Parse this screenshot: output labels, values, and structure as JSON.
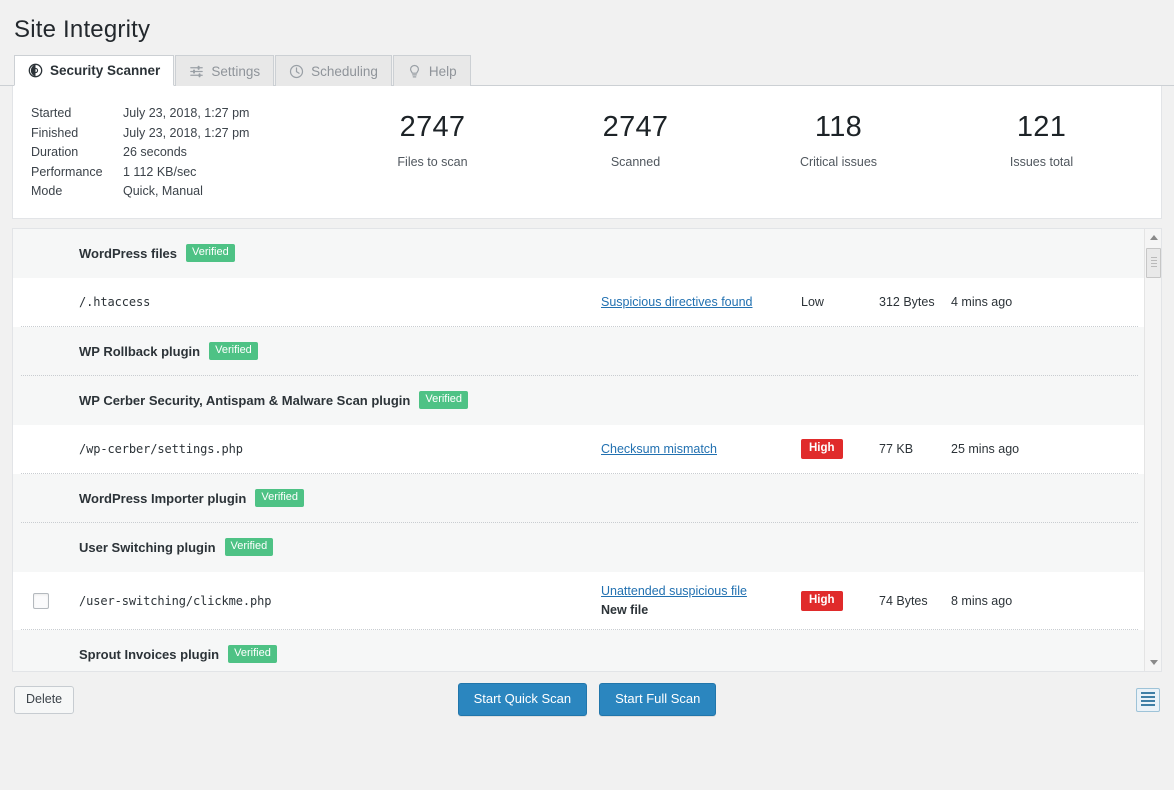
{
  "page": {
    "title": "Site Integrity"
  },
  "tabs": [
    {
      "label": "Security Scanner",
      "icon": "shield-clock-icon",
      "active": true
    },
    {
      "label": "Settings",
      "icon": "sliders-icon",
      "active": false
    },
    {
      "label": "Scheduling",
      "icon": "clock-icon",
      "active": false
    },
    {
      "label": "Help",
      "icon": "lightbulb-icon",
      "active": false
    }
  ],
  "summary": {
    "meta": [
      {
        "key": "Started",
        "value": "July 23, 2018, 1:27 pm"
      },
      {
        "key": "Finished",
        "value": "July 23, 2018, 1:27 pm"
      },
      {
        "key": "Duration",
        "value": "26 seconds"
      },
      {
        "key": "Performance",
        "value": "1 112 KB/sec"
      },
      {
        "key": "Mode",
        "value": "Quick, Manual"
      }
    ],
    "stats": [
      {
        "value": "2747",
        "label": "Files to scan"
      },
      {
        "value": "2747",
        "label": "Scanned"
      },
      {
        "value": "118",
        "label": "Critical issues"
      },
      {
        "value": "121",
        "label": "Issues total"
      }
    ]
  },
  "results": {
    "verified_badge": "Verified",
    "rows": [
      {
        "type": "group",
        "name": "WordPress files",
        "badge": "Verified"
      },
      {
        "type": "file",
        "checkbox": false,
        "name": "/.htaccess",
        "issue": "Suspicious directives found",
        "issue_sub": "",
        "severity": "Low",
        "severity_level": "low",
        "size": "312 Bytes",
        "time": "4 mins ago",
        "separator": true
      },
      {
        "type": "group",
        "name": "WP Rollback plugin",
        "badge": "Verified",
        "separator": true
      },
      {
        "type": "group",
        "name": "WP Cerber Security, Antispam & Malware Scan plugin",
        "badge": "Verified"
      },
      {
        "type": "file",
        "checkbox": false,
        "name": "/wp-cerber/settings.php",
        "issue": "Checksum mismatch",
        "issue_sub": "",
        "severity": "High",
        "severity_level": "high",
        "size": "77 KB",
        "time": "25 mins ago",
        "separator": true
      },
      {
        "type": "group",
        "name": "WordPress Importer plugin",
        "badge": "Verified",
        "separator": true
      },
      {
        "type": "group",
        "name": "User Switching plugin",
        "badge": "Verified"
      },
      {
        "type": "file",
        "checkbox": true,
        "name": "/user-switching/clickme.php",
        "issue": "Unattended suspicious file",
        "issue_sub": "New file",
        "severity": "High",
        "severity_level": "high",
        "size": "74 Bytes",
        "time": "8 mins ago",
        "separator": true
      },
      {
        "type": "group",
        "name": "Sprout Invoices plugin",
        "badge": "Verified"
      }
    ]
  },
  "toolbar": {
    "delete_label": "Delete",
    "quick_scan_label": "Start Quick Scan",
    "full_scan_label": "Start Full Scan",
    "view_toggle_icon": "list-view-icon"
  },
  "colors": {
    "accent": "#2b86bf",
    "verified": "#4ec285",
    "high": "#e02b2b",
    "link": "#2271b1",
    "page_bg": "#f1f1f1"
  }
}
